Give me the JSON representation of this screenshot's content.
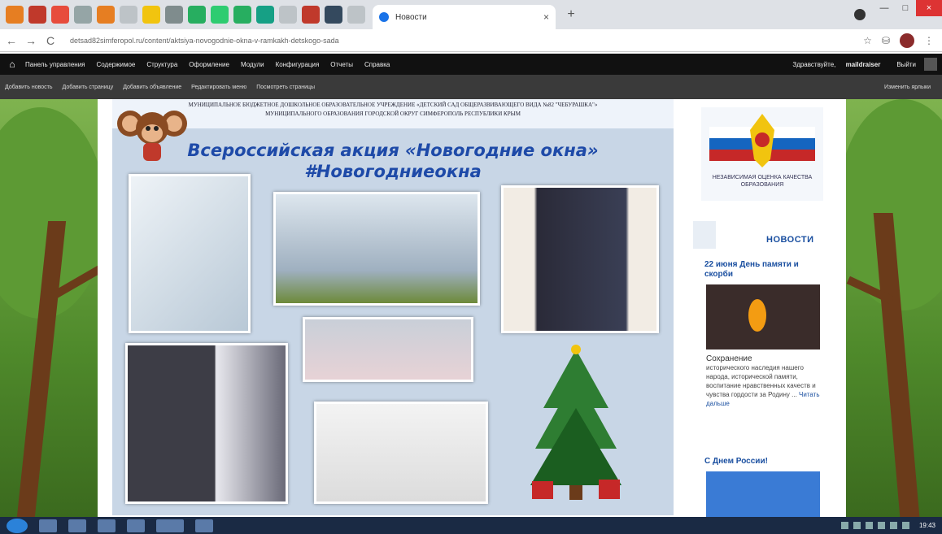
{
  "browser": {
    "tab_title": "Новости",
    "tab_close": "×",
    "new_tab": "+",
    "url": "detsad82simferopol.ru/content/aktsiya-novogodnie-okna-v-ramkakh-detskogo-sada",
    "back": "←",
    "forward": "→",
    "reload": "C",
    "star": "☆",
    "menu": "⋮",
    "win_min": "—",
    "win_max": "□",
    "win_close": "×",
    "tab_icon_colors": [
      "#e67e22",
      "#c0392b",
      "#e74c3c",
      "#95a5a6",
      "#e67e22",
      "#bdc3c7",
      "#f1c40f",
      "#7f8c8d",
      "#27ae60",
      "#2ecc71",
      "#27ae60",
      "#16a085",
      "#bdc3c7",
      "#c0392b",
      "#34495e",
      "#bdc3c7"
    ]
  },
  "admin_bar": {
    "items": [
      "Панель управления",
      "Содержимое",
      "Структура",
      "Оформление",
      "Модули",
      "Конфигурация",
      "Отчеты",
      "Справка"
    ],
    "greeting": "Здравствуйте,",
    "user": "maildraiser",
    "logout": "Выйти"
  },
  "shortcuts": {
    "items": [
      "Добавить новость",
      "Добавить страницу",
      "Добавить объявление",
      "Редактировать меню",
      "Посмотреть страницы"
    ],
    "right": "Изменить ярлыки"
  },
  "poster": {
    "header": "МУНИЦИПАЛЬНОЕ БЮДЖЕТНОЕ ДОШКОЛЬНОЕ ОБРАЗОВАТЕЛЬНОЕ УЧРЕЖДЕНИЕ «ДЕТСКИЙ САД ОБЩЕРАЗВИВАЮЩЕГО ВИДА №82 \"ЧЕБУРАШКА\"» МУНИЦИПАЛЬНОГО ОБРАЗОВАНИЯ ГОРОДСКОЙ ОКРУГ СИМФЕРОПОЛЬ РЕСПУБЛИКИ КРЫМ",
    "title_line1": "Всероссийская акция «Новогодние окна»",
    "title_line2": "#Новогодниеокна"
  },
  "sidebar": {
    "badge_text": "НЕЗАВИСИМАЯ ОЦЕНКА КАЧЕСТВА ОБРАЗОВАНИЯ",
    "news_heading": "НОВОСТИ",
    "news1_title": "22 июня День памяти и скорби",
    "news1_lead": "Сохранение",
    "news1_body": "исторического наследия нашего народа, исторической памяти, воспитание нравственных качеств и чувства гордости за Родину ...",
    "news1_more": "Читать дальше",
    "news2_title": "С Днем России!"
  },
  "taskbar": {
    "clock": "19:43"
  }
}
